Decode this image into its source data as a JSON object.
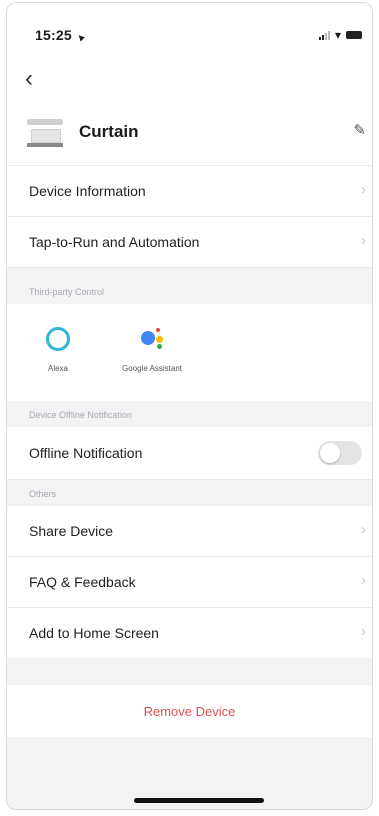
{
  "status_bar": {
    "time": "15:25",
    "arrow_icon": "location-arrow-icon"
  },
  "nav": {
    "back_icon": "chevron-left-icon"
  },
  "device": {
    "name": "Curtain",
    "edit_icon": "pencil-icon"
  },
  "rows_top": [
    {
      "label": "Device Information"
    },
    {
      "label": "Tap-to-Run and Automation"
    }
  ],
  "third_party": {
    "header": "Third-party Control",
    "items": [
      {
        "label": "Alexa",
        "icon": "alexa-icon",
        "color": "#2fb6d8"
      },
      {
        "label": "Google Assistant",
        "icon": "google-assistant-icon"
      }
    ]
  },
  "offline": {
    "header": "Device Offline Notification",
    "label": "Offline Notification",
    "enabled": false
  },
  "others": {
    "header": "Others",
    "rows": [
      {
        "label": "Share Device"
      },
      {
        "label": "FAQ & Feedback"
      },
      {
        "label": "Add to Home Screen"
      }
    ]
  },
  "remove": {
    "label": "Remove Device",
    "color": "#d9534f"
  }
}
